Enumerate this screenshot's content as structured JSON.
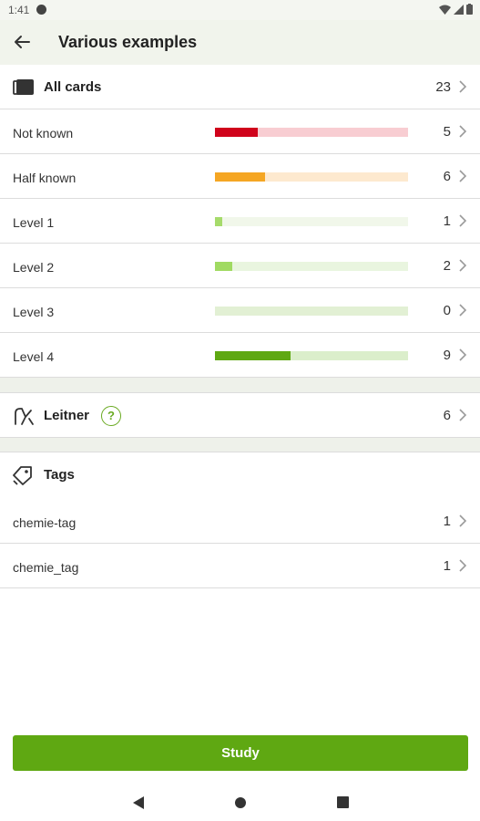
{
  "status_bar": {
    "time": "1:41"
  },
  "app_bar": {
    "title": "Various examples"
  },
  "all_cards": {
    "label": "All cards",
    "count": "23"
  },
  "levels": [
    {
      "label": "Not known",
      "count": "5",
      "fraction": 0.22,
      "fill_color": "#d0021b",
      "track_color": "#f8cdd2"
    },
    {
      "label": "Half known",
      "count": "6",
      "fraction": 0.26,
      "fill_color": "#f5a623",
      "track_color": "#fde9cf"
    },
    {
      "label": "Level 1",
      "count": "1",
      "fraction": 0.04,
      "fill_color": "#a6db6b",
      "track_color": "#f1f7ea"
    },
    {
      "label": "Level 2",
      "count": "2",
      "fraction": 0.09,
      "fill_color": "#a0da62",
      "track_color": "#e9f5df"
    },
    {
      "label": "Level 3",
      "count": "0",
      "fraction": 0.0,
      "fill_color": "#86c64a",
      "track_color": "#e2f0d4"
    },
    {
      "label": "Level 4",
      "count": "9",
      "fraction": 0.39,
      "fill_color": "#5fa812",
      "track_color": "#dbeecb"
    }
  ],
  "leitner": {
    "label": "Leitner",
    "count": "6",
    "help_icon": "?"
  },
  "tags": {
    "label": "Tags",
    "items": [
      {
        "label": "chemie-tag",
        "count": "1"
      },
      {
        "label": "chemie_tag",
        "count": "1"
      }
    ]
  },
  "study_button": {
    "label": "Study"
  },
  "colors": {
    "accent": "#5fa812",
    "app_bar_bg": "#f1f4ec"
  }
}
